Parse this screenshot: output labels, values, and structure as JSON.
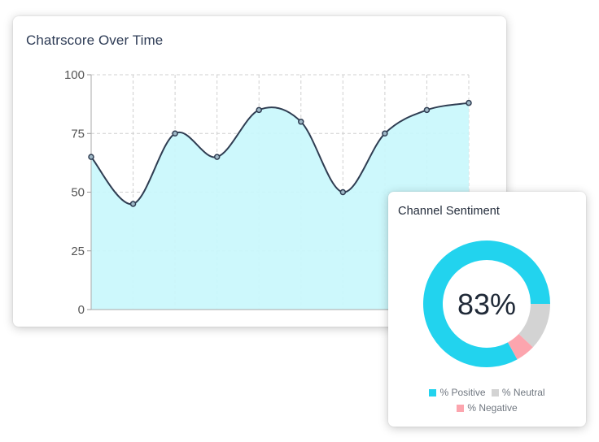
{
  "chart_title": "Chatrscore Over Time",
  "sentiment_title": "Channel Sentiment",
  "colors": {
    "line": "#2f3d52",
    "fill": "#c9f7fc",
    "positive": "#22d3ee",
    "neutral": "#d3d3d3",
    "negative": "#fca5ae",
    "grid": "#d0d0d0"
  },
  "chart_data": [
    {
      "type": "area",
      "title": "Chatrscore Over Time",
      "x": [
        1,
        2,
        3,
        4,
        5,
        6,
        7,
        8,
        9,
        10
      ],
      "values": [
        65,
        45,
        75,
        65,
        85,
        80,
        50,
        75,
        85,
        88
      ],
      "ylim": [
        0,
        100
      ],
      "yticks": [
        "0",
        "25",
        "50",
        "75",
        "100"
      ],
      "grid": true
    },
    {
      "type": "pie",
      "title": "Channel Sentiment",
      "center_label": "83%",
      "labels": [
        "% Positive",
        "% Neutral",
        "% Negative"
      ],
      "values": [
        83,
        12,
        5
      ],
      "legend": "bottom"
    }
  ]
}
